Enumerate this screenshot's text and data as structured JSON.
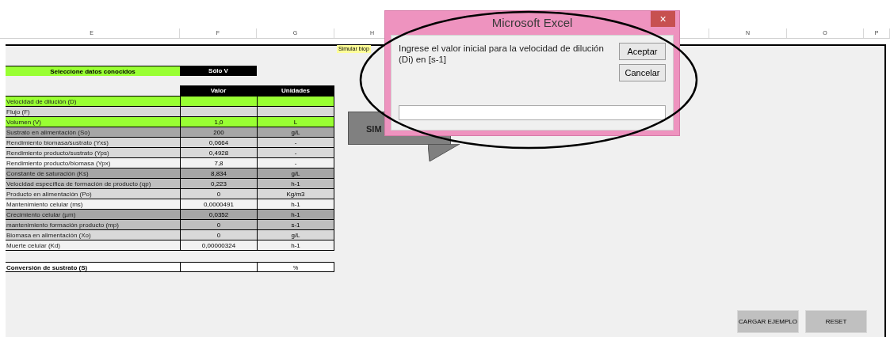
{
  "column_headers": [
    "E",
    "F",
    "G",
    "H",
    "N",
    "O",
    "P"
  ],
  "selector": {
    "label": "Seleccione datos conocidos",
    "value": "Sólo V"
  },
  "table": {
    "columns": [
      "Valor",
      "Unidades"
    ],
    "rows": [
      {
        "label": "Velocidad de dilución (D)",
        "color": "#99ff33"
      },
      {
        "label": "Flujo (F)",
        "color": "#d9d9d9"
      },
      {
        "label": "Volumen (V)",
        "value": "1,0",
        "unit": "L",
        "color": "#99ff33"
      },
      {
        "label": "Sustrato en alimentación (So)",
        "value": "200",
        "unit": "g/L",
        "color": "#a6a6a6"
      },
      {
        "label": "Rendimiento biomasa/sustrato (Yxs)",
        "value": "0,0664",
        "unit": "-",
        "color": "#d9d9d9"
      },
      {
        "label": "Rendimiento producto/sustrato (Yps)",
        "value": "0,4928",
        "unit": "-",
        "color": "#d9d9d9"
      },
      {
        "label": "Rendimiento producto/biomasa (Ypx)",
        "value": "7,8",
        "unit": "-",
        "color": "#f2f2f2"
      },
      {
        "label": "Constante de saturación (Ks)",
        "value": "8,834",
        "unit": "g/L",
        "color": "#a6a6a6"
      },
      {
        "label": "Velocidad específica de formación de producto (qp)",
        "value": "0,223",
        "unit": "h-1",
        "color": "#bfbfbf"
      },
      {
        "label": "Producto en alimentación (Po)",
        "value": "0",
        "unit": "Kg/m3",
        "color": "#d9d9d9"
      },
      {
        "label": "Mantenimiento celular (ms)",
        "value": "0,0000491",
        "unit": "h-1",
        "color": "#f2f2f2"
      },
      {
        "label": "Crecimiento celular (µm)",
        "value": "0,0352",
        "unit": "h-1",
        "color": "#a6a6a6"
      },
      {
        "label": "mantenimiento formación producto (mp)",
        "value": "0",
        "unit": "s-1",
        "color": "#bfbfbf"
      },
      {
        "label": "Biomasa en alimentación (Xo)",
        "value": "0",
        "unit": "g/L",
        "color": "#d9d9d9"
      },
      {
        "label": "Muerte celular (Kd)",
        "value": "0,00000324",
        "unit": "h-1",
        "color": "#f2f2f2"
      }
    ]
  },
  "conversion": {
    "label": "Conversión de sustrato (S)",
    "unit": "%"
  },
  "simulate_note": "Simular biop",
  "simulate_button": "SIM",
  "buttons": [
    "CARGAR EJEMPLO",
    "RESET"
  ],
  "dialog": {
    "title": "Microsoft Excel",
    "close": "×",
    "message": "Ingrese el valor inicial para la velocidad de dilución (Di) en [s-1]",
    "buttons": [
      "Aceptar",
      "Cancelar"
    ]
  }
}
